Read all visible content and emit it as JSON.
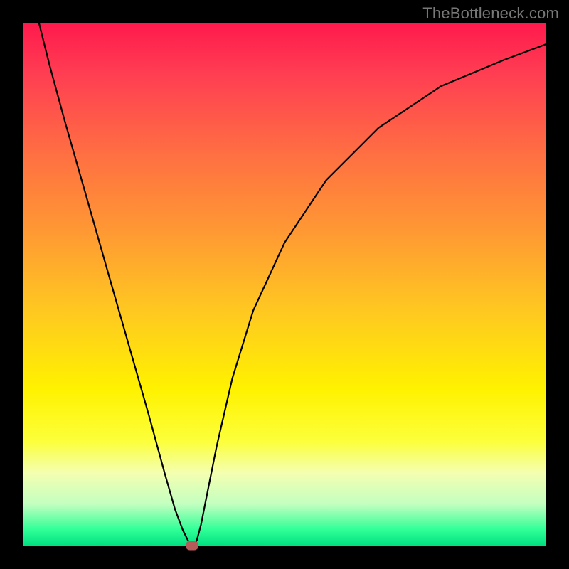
{
  "watermark": "TheBottleneck.com",
  "chart_data": {
    "type": "line",
    "title": "",
    "xlabel": "",
    "ylabel": "",
    "xlim": [
      0,
      100
    ],
    "ylim": [
      0,
      100
    ],
    "series": [
      {
        "name": "bottleneck-curve",
        "x": [
          3,
          5,
          8,
          12,
          16,
          20,
          24,
          27,
          29,
          30.5,
          31.5,
          32,
          32.3,
          32.7,
          33.2,
          34,
          35,
          37,
          40,
          44,
          50,
          58,
          68,
          80,
          92,
          100
        ],
        "y": [
          100,
          92,
          81,
          67,
          53,
          39,
          25,
          14,
          7,
          3,
          1,
          0.2,
          0,
          0.2,
          1,
          4,
          9,
          19,
          32,
          45,
          58,
          70,
          80,
          88,
          93,
          96
        ]
      }
    ],
    "marker": {
      "x": 32.3,
      "y": 0
    },
    "gradient_stops": [
      {
        "pct": 0,
        "color": "#ff1a4d"
      },
      {
        "pct": 25,
        "color": "#ff6f42"
      },
      {
        "pct": 55,
        "color": "#ffc821"
      },
      {
        "pct": 80,
        "color": "#fcff3a"
      },
      {
        "pct": 100,
        "color": "#00e080"
      }
    ]
  }
}
